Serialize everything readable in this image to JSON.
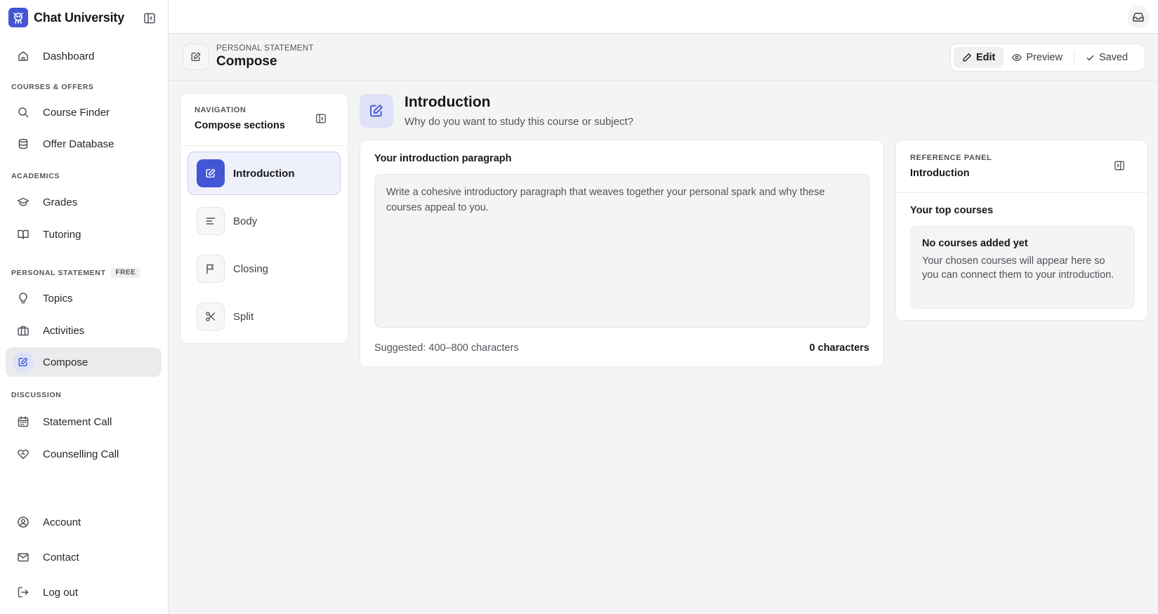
{
  "app": {
    "name": "Chat University"
  },
  "sidebar": {
    "sections": {
      "courses": "COURSES & OFFERS",
      "academics": "ACADEMICS",
      "personal_statement": "PERSONAL STATEMENT",
      "personal_statement_badge": "FREE",
      "discussion": "DISCUSSION"
    },
    "items": {
      "dashboard": "Dashboard",
      "course_finder": "Course Finder",
      "offer_database": "Offer Database",
      "grades": "Grades",
      "tutoring": "Tutoring",
      "topics": "Topics",
      "activities": "Activities",
      "compose": "Compose",
      "statement_call": "Statement Call",
      "counselling_call": "Counselling Call",
      "account": "Account",
      "contact": "Contact",
      "log_out": "Log out"
    },
    "active_item": "compose"
  },
  "page_header": {
    "eyebrow": "PERSONAL STATEMENT",
    "title": "Compose",
    "modes": {
      "edit": "Edit",
      "preview": "Preview",
      "saved": "Saved"
    },
    "active_mode": "edit"
  },
  "sections_nav": {
    "eyebrow": "NAVIGATION",
    "title": "Compose sections",
    "items": [
      "Introduction",
      "Body",
      "Closing",
      "Split"
    ],
    "active_index": 0
  },
  "section": {
    "title": "Introduction",
    "subtitle": "Why do you want to study this course or subject?"
  },
  "editor": {
    "label": "Your introduction paragraph",
    "value": "",
    "placeholder": "Write a cohesive introductory paragraph that weaves together your personal spark and why these courses appeal to you.",
    "hint": "Suggested: 400–800 characters",
    "count": "0 characters"
  },
  "reference": {
    "eyebrow": "REFERENCE PANEL",
    "title": "Introduction",
    "subtitle": "Your top courses",
    "empty_title": "No courses added yet",
    "empty_text": "Your chosen courses will appear here so you can connect them to your introduction."
  },
  "colors": {
    "accent": "#4356d6",
    "accent_soft": "#dfe2f7",
    "background": "#f4f4f5"
  }
}
